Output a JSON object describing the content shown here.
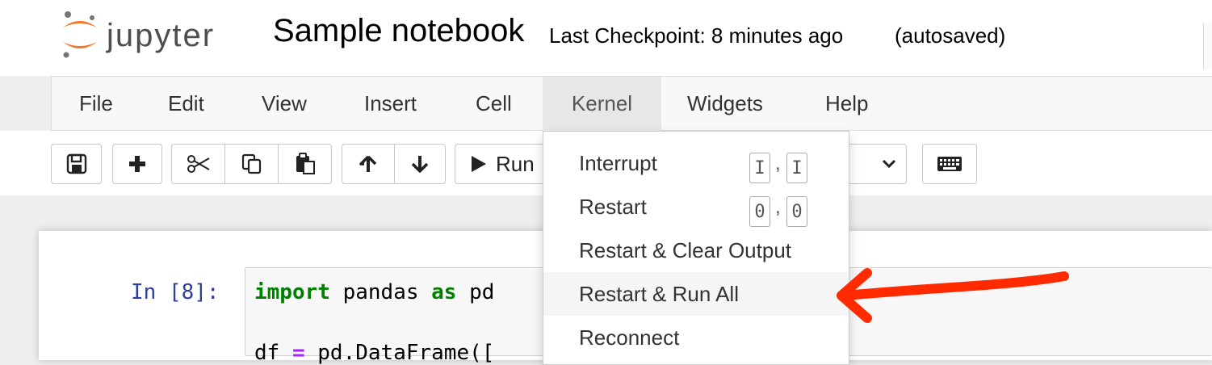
{
  "header": {
    "logo_text": "jupyter",
    "notebook_title": "Sample notebook",
    "checkpoint_text": "Last Checkpoint: 8 minutes ago",
    "autosave_text": "(autosaved)"
  },
  "menubar": {
    "items": [
      "File",
      "Edit",
      "View",
      "Insert",
      "Cell",
      "Kernel",
      "Widgets",
      "Help"
    ],
    "active": "Kernel"
  },
  "toolbar": {
    "run_label": "Run",
    "icons": [
      "save-icon",
      "plus-icon",
      "scissors-icon",
      "copy-icon",
      "paste-icon",
      "arrow-up-icon",
      "arrow-down-icon",
      "play-icon",
      "chevron-down-icon",
      "keyboard-icon"
    ]
  },
  "cell": {
    "prompt": "In [8]:",
    "line1": {
      "kw1": "import",
      "mid": " pandas ",
      "kw2": "as",
      "tail": " pd"
    },
    "line2": {
      "a": "df ",
      "op": "=",
      "b": " pd.DataFrame(["
    }
  },
  "kernel_menu": {
    "items": [
      {
        "label": "Interrupt",
        "shortcut": [
          "I",
          ",",
          "I"
        ]
      },
      {
        "label": "Restart",
        "shortcut": [
          "0",
          ",",
          "0"
        ]
      },
      {
        "label": "Restart & Clear Output"
      },
      {
        "label": "Restart & Run All"
      },
      {
        "label": "Reconnect"
      }
    ],
    "highlighted": "Restart & Run All"
  },
  "colors": {
    "logo_orange": "#f37726",
    "annotation_arrow": "#ff2a00",
    "prompt_blue": "#303f9f",
    "keyword_green": "#008000",
    "operator_purple": "#aa22ff"
  }
}
